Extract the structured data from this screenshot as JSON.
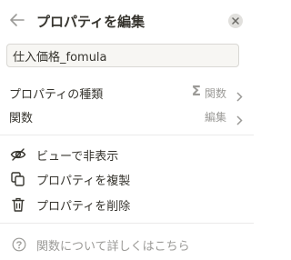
{
  "header": {
    "back_icon": "arrow-left-icon",
    "title": "プロパティを編集",
    "close_icon": "close-icon"
  },
  "name_field": {
    "value": "仕入価格_fomula"
  },
  "property_rows": [
    {
      "label": "プロパティの種類",
      "value": "関数",
      "value_icon": "sigma-icon",
      "value_icon_glyph": "Σ",
      "chevron": "chevron-right-icon"
    },
    {
      "label": "関数",
      "value": "編集",
      "chevron": "chevron-right-icon"
    }
  ],
  "actions": [
    {
      "label": "ビューで非表示",
      "icon": "eye-slash-icon"
    },
    {
      "label": "プロパティを複製",
      "icon": "duplicate-icon"
    },
    {
      "label": "プロパティを削除",
      "icon": "trash-icon"
    }
  ],
  "help": {
    "label": "関数について詳しくはこちら",
    "icon": "help-circle-icon"
  }
}
